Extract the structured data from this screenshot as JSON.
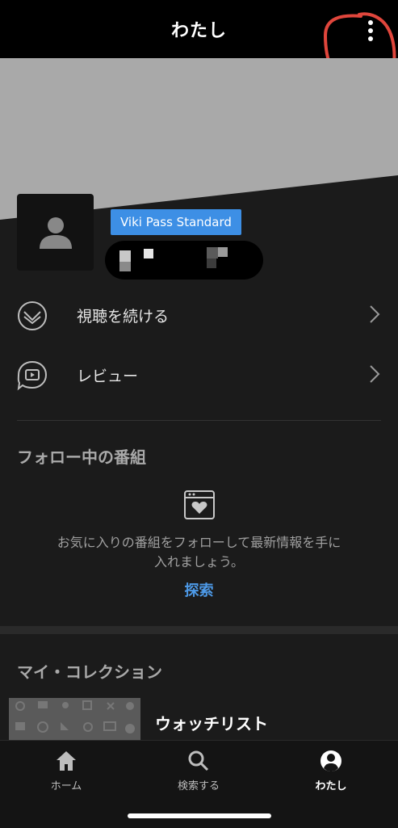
{
  "header": {
    "title": "わたし"
  },
  "profile": {
    "badge": "Viki Pass Standard"
  },
  "menu": {
    "items": [
      {
        "label": "視聴を続ける",
        "icon": "continue-watching-icon"
      },
      {
        "label": "レビュー",
        "icon": "review-icon"
      }
    ]
  },
  "following": {
    "title": "フォロー中の番組",
    "empty_line1": "お気に入りの番組をフォローして最新情報を手に",
    "empty_line2": "入れましょう。",
    "explore": "探索"
  },
  "collection": {
    "title": "マイ・コレクション",
    "watchlist_label": "ウォッチリスト"
  },
  "tabs": [
    {
      "label": "ホーム",
      "icon": "home-icon",
      "active": false
    },
    {
      "label": "検索する",
      "icon": "search-icon",
      "active": false
    },
    {
      "label": "わたし",
      "icon": "profile-icon",
      "active": true
    }
  ],
  "colors": {
    "accent": "#3d8fe5",
    "annotation": "#e0463c",
    "background": "#1b1b1b"
  }
}
